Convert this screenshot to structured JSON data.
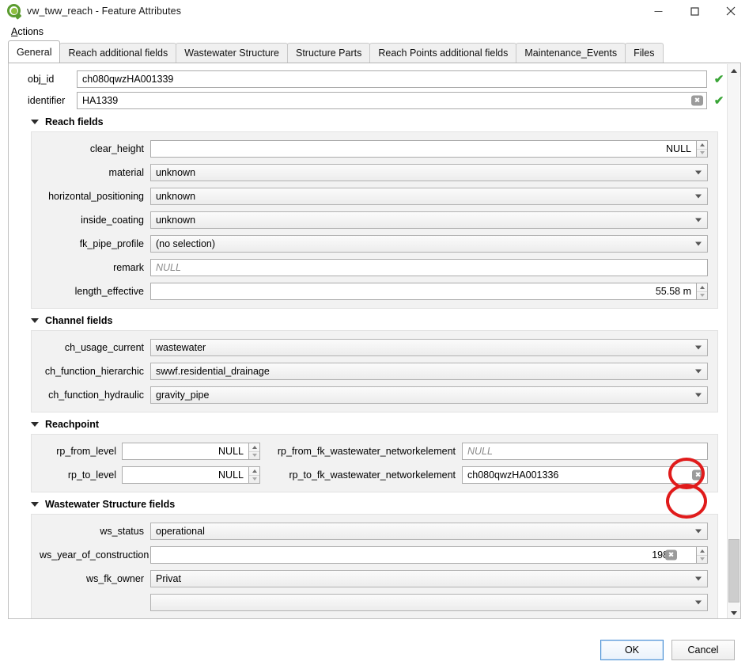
{
  "window": {
    "title": "vw_tww_reach - Feature Attributes",
    "logo_icon": "qgis-logo-icon",
    "minimize_label": "–",
    "maximize_label": "□",
    "close_label": "✕"
  },
  "menubar": {
    "items": [
      {
        "label": "Actions",
        "mnemonic": "A"
      }
    ]
  },
  "tabs": [
    {
      "label": "General",
      "active": true
    },
    {
      "label": "Reach additional fields",
      "active": false
    },
    {
      "label": "Wastewater Structure",
      "active": false
    },
    {
      "label": "Structure Parts",
      "active": false
    },
    {
      "label": "Reach Points additional fields",
      "active": false
    },
    {
      "label": "Maintenance_Events",
      "active": false
    },
    {
      "label": "Files",
      "active": false
    }
  ],
  "top_fields": [
    {
      "label": "obj_id",
      "value": "ch080qwzHA001339",
      "has_clear": false,
      "valid_icon": "checkmark-icon",
      "valid_color": "#3aa537"
    },
    {
      "label": "identifier",
      "value": "HA1339",
      "has_clear": true,
      "clear_icon": "clear-x-icon",
      "valid_icon": "checkmark-icon",
      "valid_color": "#3aa537"
    }
  ],
  "groups": [
    {
      "title": "Reach fields",
      "collapse_icon": "triangle-down-icon",
      "rows": [
        {
          "label": "clear_height",
          "type": "spinbox",
          "value": "NULL",
          "align": "right"
        },
        {
          "label": "material",
          "type": "combo",
          "value": "unknown"
        },
        {
          "label": "horizontal_positioning",
          "type": "combo",
          "value": "unknown"
        },
        {
          "label": "inside_coating",
          "type": "combo",
          "value": "unknown"
        },
        {
          "label": "fk_pipe_profile",
          "type": "combo",
          "value": "(no selection)"
        },
        {
          "label": "remark",
          "type": "text",
          "value": "",
          "placeholder": "NULL"
        },
        {
          "label": "length_effective",
          "type": "spinbox",
          "value": "55.58 m",
          "align": "right"
        }
      ]
    },
    {
      "title": "Channel fields",
      "collapse_icon": "triangle-down-icon",
      "rows": [
        {
          "label": "ch_usage_current",
          "type": "combo",
          "value": "wastewater"
        },
        {
          "label": "ch_function_hierarchic",
          "type": "combo",
          "value": "swwf.residential_drainage"
        },
        {
          "label": "ch_function_hydraulic",
          "type": "combo",
          "value": "gravity_pipe"
        }
      ]
    }
  ],
  "reachpoint": {
    "title": "Reachpoint",
    "collapse_icon": "triangle-down-icon",
    "rows": [
      {
        "left_label": "rp_from_level",
        "left_value": "NULL",
        "right_label": "rp_from_fk_wastewater_networkelement",
        "right_value": "",
        "right_placeholder": "NULL",
        "right_has_clear": false
      },
      {
        "left_label": "rp_to_level",
        "left_value": "NULL",
        "right_label": "rp_to_fk_wastewater_networkelement",
        "right_value": "ch080qwzHA001336",
        "right_placeholder": "",
        "right_has_clear": true,
        "clear_icon": "clear-x-icon"
      }
    ]
  },
  "ws_group": {
    "title": "Wastewater Structure fields",
    "collapse_icon": "triangle-down-icon",
    "rows": [
      {
        "label": "ws_status",
        "type": "combo",
        "value": "operational"
      },
      {
        "label": "ws_year_of_construction",
        "type": "spinbox_clear",
        "value": "1989",
        "clear_icon": "clear-x-icon"
      },
      {
        "label": "ws_fk_owner",
        "type": "combo",
        "value": "Privat"
      }
    ]
  },
  "scrollbar": {
    "up_icon": "scroll-up-arrow-icon",
    "down_icon": "scroll-down-arrow-icon"
  },
  "buttons": {
    "ok_label": "OK",
    "cancel_label": "Cancel"
  },
  "annotations": {
    "color": "#e01b1b",
    "shapes": [
      {
        "name": "highlight-ellipse-top"
      },
      {
        "name": "highlight-ellipse-bottom"
      }
    ]
  }
}
